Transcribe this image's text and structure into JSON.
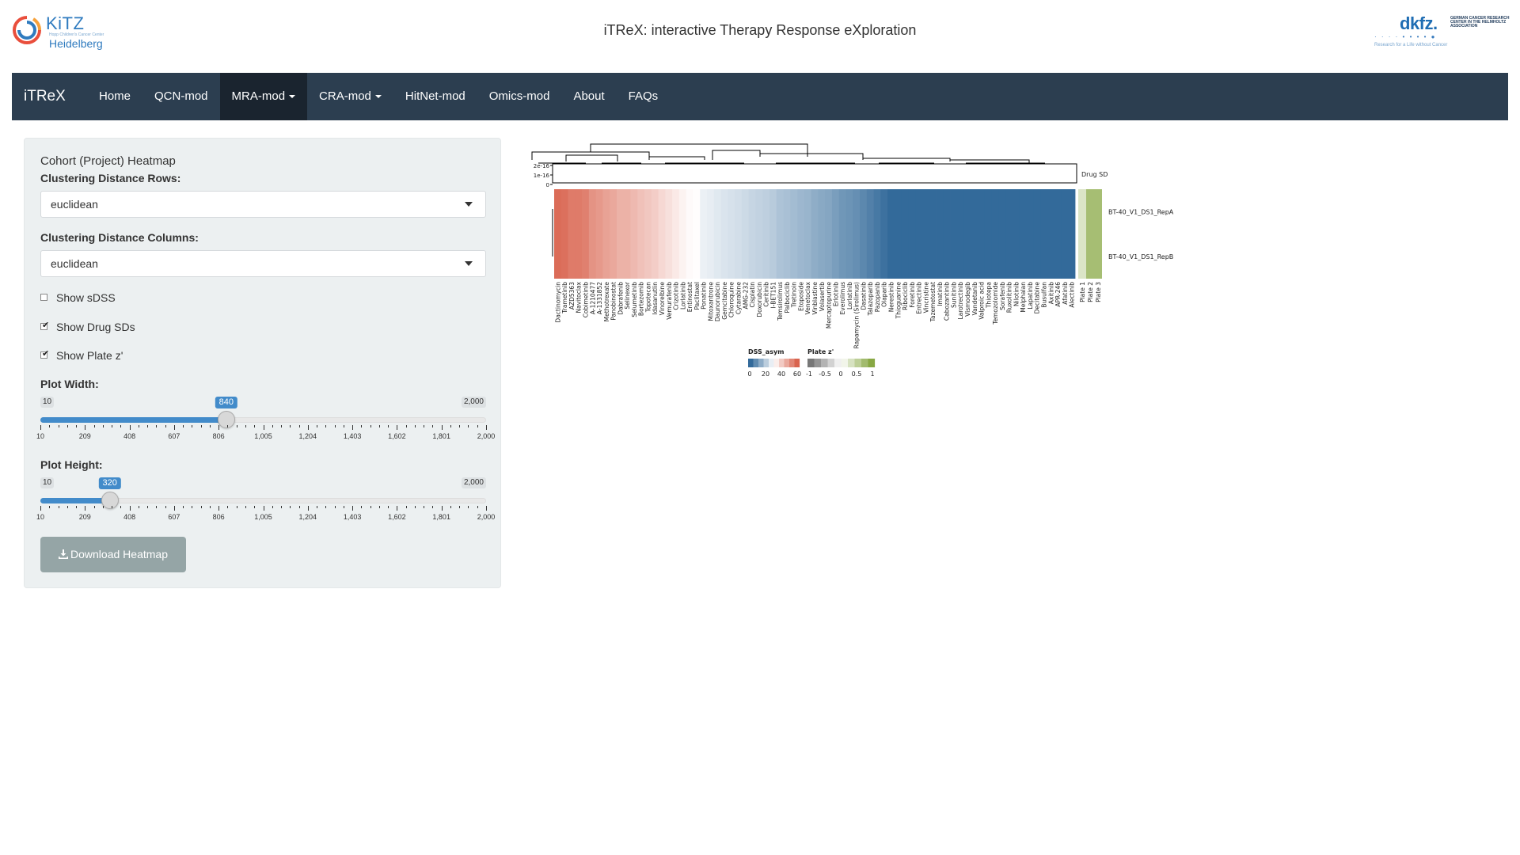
{
  "header": {
    "logo_left": {
      "name": "KiTZ",
      "tagline": "Hopp Children's Cancer Center",
      "city": "Heidelberg"
    },
    "title": "iTReX: interactive Therapy Response eXploration",
    "logo_right": {
      "name": "dkfz.",
      "sub": "GERMAN CANCER RESEARCH CENTER IN THE HELMHOLTZ ASSOCIATION",
      "tagline": "Research for a Life without Cancer"
    }
  },
  "nav": {
    "brand": "iTReX",
    "items": [
      {
        "label": "Home",
        "active": false,
        "dropdown": false
      },
      {
        "label": "QCN-mod",
        "active": false,
        "dropdown": false
      },
      {
        "label": "MRA-mod",
        "active": true,
        "dropdown": true
      },
      {
        "label": "CRA-mod",
        "active": false,
        "dropdown": true
      },
      {
        "label": "HitNet-mod",
        "active": false,
        "dropdown": false
      },
      {
        "label": "Omics-mod",
        "active": false,
        "dropdown": false
      },
      {
        "label": "About",
        "active": false,
        "dropdown": false
      },
      {
        "label": "FAQs",
        "active": false,
        "dropdown": false
      }
    ]
  },
  "sidebar": {
    "title": "Cohort (Project) Heatmap",
    "dist_rows_label": "Clustering Distance Rows:",
    "dist_rows_value": "euclidean",
    "dist_cols_label": "Clustering Distance Columns:",
    "dist_cols_value": "euclidean",
    "checkboxes": [
      {
        "label": "Show sDSS",
        "checked": false
      },
      {
        "label": "Show Drug SDs",
        "checked": true
      },
      {
        "label": "Show Plate z'",
        "checked": true
      }
    ],
    "width_slider": {
      "label": "Plot Width:",
      "min": "10",
      "max": "2,000",
      "value": "840",
      "fraction": 0.4171
    },
    "height_slider": {
      "label": "Plot Height:",
      "min": "10",
      "max": "2,000",
      "value": "320",
      "fraction": 0.1558
    },
    "tick_labels": [
      "10",
      "209",
      "408",
      "607",
      "806",
      "1,005",
      "1,204",
      "1,403",
      "1,602",
      "1,801",
      "2,000"
    ],
    "download_label": "Download Heatmap"
  },
  "chart_data": {
    "type": "heatmap",
    "rows": [
      "BT-40_V1_DS1_RepA",
      "BT-40_V1_DS1_RepB"
    ],
    "columns": [
      "Dactinomycin",
      "Trametinib",
      "AZD5363",
      "Navitoclax",
      "Cobimetinib",
      "A-1210477",
      "A-1331852",
      "Methotrexate",
      "Panobinostat",
      "Dabrafenib",
      "Selinexor",
      "Selumetinib",
      "Bortezomib",
      "Topotecan",
      "Idasanutlin",
      "Vinorelbine",
      "Vemurafenib",
      "Crizotinib",
      "Lorlatinib",
      "Entinostat",
      "Paclitaxel",
      "Ponatinib",
      "Mitoxantrone",
      "Daunorubicin",
      "Gemcitabine",
      "Chloroquine",
      "Cytarabine",
      "AMG-232",
      "Cisplatin",
      "Doxorubicin",
      "Ceritinib",
      "I-BET151",
      "Temsirolimus",
      "Palbociclib",
      "Tretinoin",
      "Etoposide",
      "Venetoclax",
      "Vinblastine",
      "Volasertib",
      "Mercaptopurine",
      "Erlotinib",
      "Everolimus",
      "Lorlatinib",
      "Rapamycin (Sirolimus)",
      "Dasatinib",
      "Talazoparib",
      "Pazopanib",
      "Olaparib",
      "Nerestinib",
      "Thioguanine",
      "Ribociclib",
      "Foretinib",
      "Entrectinib",
      "Vincristine",
      "Tazemetostat",
      "Imatinib",
      "Cabozantinib",
      "Sunitinib",
      "Larotrectinib",
      "Vismodegib",
      "Vandetanib",
      "Valproic acid",
      "Thiotepa",
      "Temozolomide",
      "Sorafenib",
      "Ruxolitinib",
      "Nilotinib",
      "Melphalan",
      "Lapatinib",
      "Decitabine",
      "Busulfan",
      "Axitinib",
      "APR-246",
      "Afatinib",
      "Alectinib"
    ],
    "dss_values": [
      55,
      50,
      45,
      45,
      42,
      35,
      33,
      30,
      28,
      26,
      26,
      24,
      22,
      20,
      18,
      14,
      12,
      9,
      6,
      2,
      1,
      0,
      0,
      0,
      0,
      0,
      0,
      0,
      0,
      0,
      0,
      0,
      0,
      0,
      0,
      0,
      0,
      0,
      0,
      0,
      0,
      0,
      0,
      0,
      0,
      0,
      0,
      0,
      0,
      0,
      0,
      0,
      0,
      0,
      0,
      0,
      0,
      0,
      0,
      0,
      0,
      0,
      0,
      0,
      0,
      0,
      0,
      0,
      0,
      0,
      0,
      0,
      0,
      0,
      0
    ],
    "shades": [
      0.95,
      0.92,
      0.85,
      0.85,
      0.82,
      0.7,
      0.66,
      0.6,
      0.56,
      0.5,
      0.5,
      0.45,
      0.4,
      0.36,
      0.32,
      0.25,
      0.2,
      0.14,
      0.08,
      0.03,
      0.01,
      -0.1,
      -0.12,
      -0.15,
      -0.18,
      -0.2,
      -0.22,
      -0.25,
      -0.28,
      -0.3,
      -0.32,
      -0.35,
      -0.4,
      -0.42,
      -0.45,
      -0.48,
      -0.5,
      -0.55,
      -0.58,
      -0.6,
      -0.65,
      -0.7,
      -0.72,
      -0.75,
      -0.8,
      -0.85,
      -0.9,
      -0.95,
      -1,
      -1,
      -1,
      -1,
      -1,
      -1,
      -1,
      -1,
      -1,
      -1,
      -1,
      -1,
      -1,
      -1,
      -1,
      -1,
      -1,
      -1,
      -1,
      -1,
      -1,
      -1,
      -1,
      -1,
      -1,
      -1,
      -1
    ],
    "drug_sd_axis": [
      "2e-16",
      "1e-16",
      "0"
    ],
    "drug_sd_label": "Drug SD",
    "plates": [
      "Plate 1",
      "Plate 2",
      "Plate 3"
    ],
    "plate_z": [
      0.3,
      0.75,
      0.75
    ],
    "legend_dss": {
      "title": "DSS_asym",
      "ticks": [
        "0",
        "20",
        "40",
        "60"
      ]
    },
    "legend_plate": {
      "title": "Plate z'",
      "ticks": [
        "-1",
        "-0.5",
        "0",
        "0.5",
        "1"
      ]
    },
    "colors": {
      "low": "#336a9a",
      "mid": "#ffffff",
      "high": "#d9644f",
      "plate_low": "#777777",
      "plate_high": "#88a844"
    }
  }
}
